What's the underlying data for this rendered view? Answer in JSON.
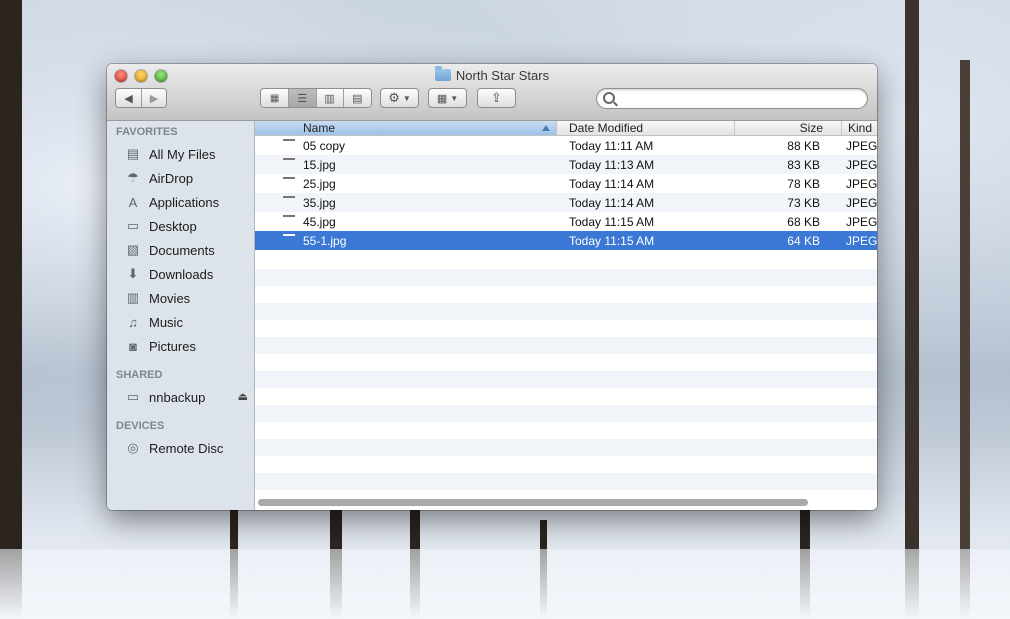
{
  "window": {
    "title": "North Star Stars"
  },
  "toolbar": {
    "back_icon": "back-icon",
    "forward_icon": "forward-icon",
    "view_modes": [
      "icon-view",
      "list-view",
      "column-view",
      "coverflow-view"
    ],
    "active_view": "list-view",
    "action_icon": "gear-icon",
    "arrange_icon": "arrange-icon",
    "share_icon": "share-icon"
  },
  "search": {
    "value": "",
    "placeholder": ""
  },
  "sidebar": {
    "favorites_header": "FAVORITES",
    "favorites": [
      {
        "label": "All My Files",
        "icon": "all-files-icon"
      },
      {
        "label": "AirDrop",
        "icon": "airdrop-icon"
      },
      {
        "label": "Applications",
        "icon": "applications-icon"
      },
      {
        "label": "Desktop",
        "icon": "desktop-icon"
      },
      {
        "label": "Documents",
        "icon": "documents-icon"
      },
      {
        "label": "Downloads",
        "icon": "downloads-icon"
      },
      {
        "label": "Movies",
        "icon": "movies-icon"
      },
      {
        "label": "Music",
        "icon": "music-icon"
      },
      {
        "label": "Pictures",
        "icon": "pictures-icon"
      }
    ],
    "shared_header": "SHARED",
    "shared": [
      {
        "label": "nnbackup",
        "icon": "server-icon",
        "eject": true
      }
    ],
    "devices_header": "DEVICES",
    "devices": [
      {
        "label": "Remote Disc",
        "icon": "disc-icon"
      }
    ]
  },
  "columns": {
    "name": "Name",
    "date": "Date Modified",
    "size": "Size",
    "kind": "Kind"
  },
  "files": [
    {
      "name": "05 copy",
      "date": "Today 11:11 AM",
      "size": "88 KB",
      "kind": "JPEG"
    },
    {
      "name": "15.jpg",
      "date": "Today 11:13 AM",
      "size": "83 KB",
      "kind": "JPEG"
    },
    {
      "name": "25.jpg",
      "date": "Today 11:14 AM",
      "size": "78 KB",
      "kind": "JPEG"
    },
    {
      "name": "35.jpg",
      "date": "Today 11:14 AM",
      "size": "73 KB",
      "kind": "JPEG"
    },
    {
      "name": "45.jpg",
      "date": "Today 11:15 AM",
      "size": "68 KB",
      "kind": "JPEG"
    },
    {
      "name": "55-1.jpg",
      "date": "Today 11:15 AM",
      "size": "64 KB",
      "kind": "JPEG",
      "selected": true
    }
  ],
  "colors": {
    "selection": "#3b78d6",
    "sidebar": "#dde3ea",
    "row_alt": "#f1f5fa"
  }
}
